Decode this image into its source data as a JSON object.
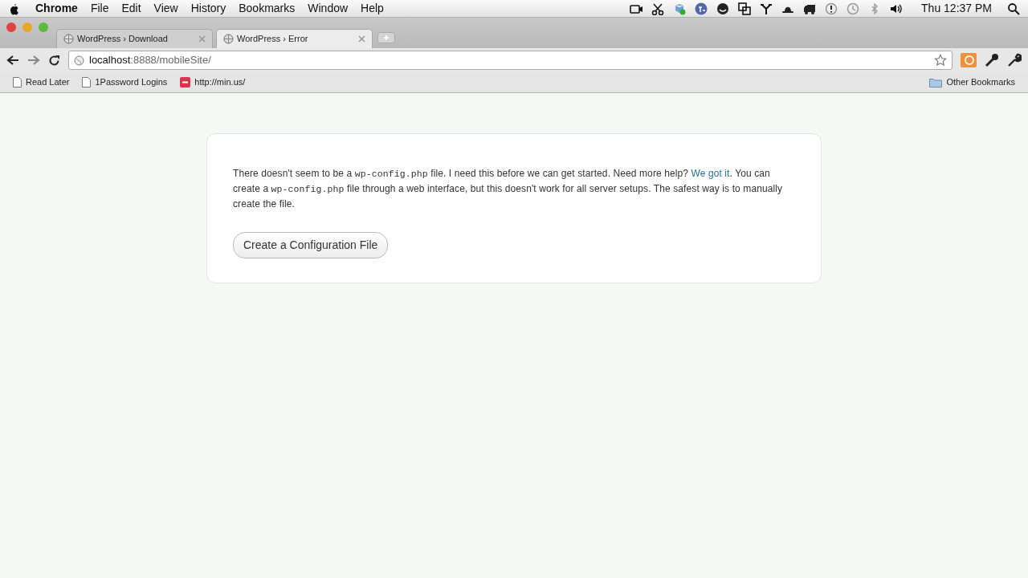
{
  "menu_bar": {
    "app": "Chrome",
    "items": [
      "File",
      "Edit",
      "View",
      "History",
      "Bookmarks",
      "Window",
      "Help"
    ],
    "clock": "Thu 12:37 PM"
  },
  "tabs": [
    {
      "label": "WordPress › Download",
      "selected": false
    },
    {
      "label": "WordPress › Error",
      "selected": true
    }
  ],
  "address_bar": {
    "host": "localhost",
    "path": ":8888/mobileSite/"
  },
  "bookmarks": [
    {
      "label": "Read Later",
      "kind": "page"
    },
    {
      "label": "1Password Logins",
      "kind": "page"
    },
    {
      "label": "http://min.us/",
      "kind": "minus"
    }
  ],
  "other_bookmarks": "Other Bookmarks",
  "message": [
    {
      "kind": "text",
      "text": "There doesn't seem to be a "
    },
    {
      "kind": "code",
      "text": "wp-config.php"
    },
    {
      "kind": "text",
      "text": " file. I need this before we can get started. Need more help? "
    },
    {
      "kind": "link",
      "text": "We got it"
    },
    {
      "kind": "text",
      "text": ". You can create a "
    },
    {
      "kind": "code",
      "text": "wp-config.php"
    },
    {
      "kind": "text",
      "text": " file through a web interface, but this doesn't work for all server setups. The safest way is to manually create the file."
    }
  ],
  "button": "Create a Configuration File"
}
